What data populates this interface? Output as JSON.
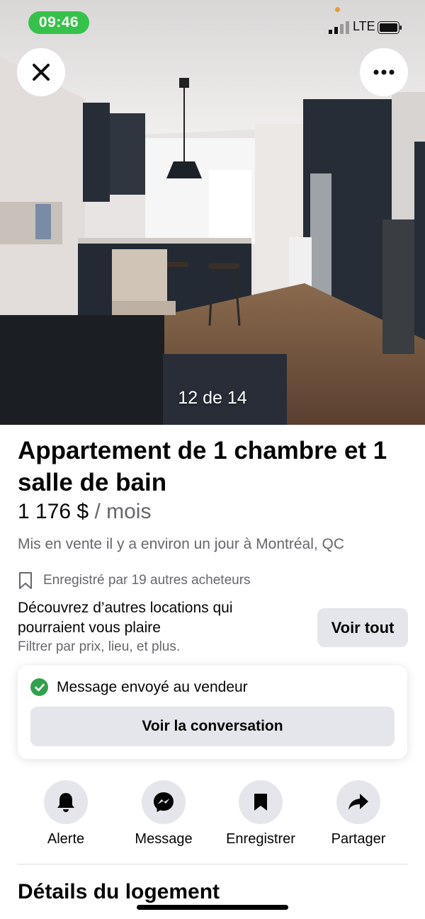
{
  "status_bar": {
    "time": "09:46",
    "network": "LTE"
  },
  "photo": {
    "counter": "12 de 14"
  },
  "listing": {
    "title": "Appartement de 1 chambre et 1 salle de bain",
    "price": "1 176 $",
    "price_period": "/ mois",
    "listed_text": "Mis en vente il y a environ un jour à Montréal, QC",
    "saved_text": "Enregistré par 19 autres acheteurs"
  },
  "discover": {
    "title": "Découvrez d’autres locations qui pourraient vous plaire",
    "subtitle": "Filtrer par prix, lieu, et plus.",
    "button_label": "Voir tout"
  },
  "message_card": {
    "status": "Message envoyé au vendeur",
    "button_label": "Voir la conversation"
  },
  "actions": [
    {
      "label": "Alerte",
      "icon": "bell-icon"
    },
    {
      "label": "Message",
      "icon": "messenger-icon"
    },
    {
      "label": "Enregistrer",
      "icon": "bookmark-icon"
    },
    {
      "label": "Partager",
      "icon": "share-icon"
    }
  ],
  "details_heading": "Détails du logement",
  "colors": {
    "success": "#31a24c",
    "time_pill": "#36c24a",
    "secondary_text": "#65676b",
    "button_bg": "#e4e6eb"
  }
}
